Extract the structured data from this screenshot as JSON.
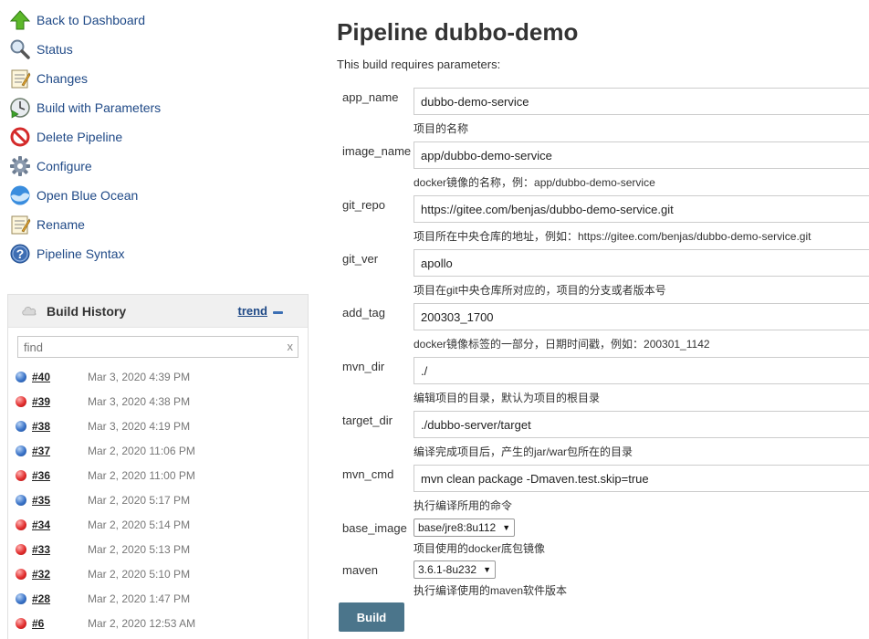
{
  "sidebar": {
    "tasks": [
      {
        "label": "Back to Dashboard",
        "icon": "up-arrow-icon"
      },
      {
        "label": "Status",
        "icon": "magnifier-icon"
      },
      {
        "label": "Changes",
        "icon": "notepad-icon"
      },
      {
        "label": "Build with Parameters",
        "icon": "clock-play-icon"
      },
      {
        "label": "Delete Pipeline",
        "icon": "no-entry-icon"
      },
      {
        "label": "Configure",
        "icon": "gear-icon"
      },
      {
        "label": "Open Blue Ocean",
        "icon": "blue-ocean-icon"
      },
      {
        "label": "Rename",
        "icon": "notepad-icon"
      },
      {
        "label": "Pipeline Syntax",
        "icon": "help-icon"
      }
    ]
  },
  "build_history": {
    "title": "Build History",
    "trend_label": "trend",
    "search_placeholder": "find",
    "clear_label": "x",
    "builds": [
      {
        "number": "#40",
        "date": "Mar 3, 2020 4:39 PM",
        "status": "blue"
      },
      {
        "number": "#39",
        "date": "Mar 3, 2020 4:38 PM",
        "status": "red"
      },
      {
        "number": "#38",
        "date": "Mar 3, 2020 4:19 PM",
        "status": "blue"
      },
      {
        "number": "#37",
        "date": "Mar 2, 2020 11:06 PM",
        "status": "blue"
      },
      {
        "number": "#36",
        "date": "Mar 2, 2020 11:00 PM",
        "status": "red"
      },
      {
        "number": "#35",
        "date": "Mar 2, 2020 5:17 PM",
        "status": "blue"
      },
      {
        "number": "#34",
        "date": "Mar 2, 2020 5:14 PM",
        "status": "red"
      },
      {
        "number": "#33",
        "date": "Mar 2, 2020 5:13 PM",
        "status": "red"
      },
      {
        "number": "#32",
        "date": "Mar 2, 2020 5:10 PM",
        "status": "red"
      },
      {
        "number": "#28",
        "date": "Mar 2, 2020 1:47 PM",
        "status": "blue"
      },
      {
        "number": "#6",
        "date": "Mar 2, 2020 12:53 AM",
        "status": "red"
      }
    ]
  },
  "main": {
    "title": "Pipeline dubbo-demo",
    "requires_text": "This build requires parameters:",
    "build_label": "Build",
    "params": [
      {
        "name": "app_name",
        "value": "dubbo-demo-service",
        "description": "项目的名称",
        "type": "text"
      },
      {
        "name": "image_name",
        "value": "app/dubbo-demo-service",
        "description": "docker镜像的名称，例：app/dubbo-demo-service",
        "type": "text"
      },
      {
        "name": "git_repo",
        "value": "https://gitee.com/benjas/dubbo-demo-service.git",
        "description": "项目所在中央仓库的地址，例如：https://gitee.com/benjas/dubbo-demo-service.git",
        "type": "text"
      },
      {
        "name": "git_ver",
        "value": "apollo",
        "description": "项目在git中央仓库所对应的，项目的分支或者版本号",
        "type": "text"
      },
      {
        "name": "add_tag",
        "value": "200303_1700",
        "description": "docker镜像标签的一部分，日期时间戳，例如：200301_1142",
        "type": "text"
      },
      {
        "name": "mvn_dir",
        "value": "./",
        "description": "编辑项目的目录，默认为项目的根目录",
        "type": "text"
      },
      {
        "name": "target_dir",
        "value": "./dubbo-server/target",
        "description": "编译完成项目后，产生的jar/war包所在的目录",
        "type": "text"
      },
      {
        "name": "mvn_cmd",
        "value": "mvn clean package -Dmaven.test.skip=true",
        "description": "执行编译所用的命令",
        "type": "text"
      },
      {
        "name": "base_image",
        "value": "base/jre8:8u112",
        "description": "项目使用的docker底包镜像",
        "type": "select"
      },
      {
        "name": "maven",
        "value": "3.6.1-8u232",
        "description": "执行编译使用的maven软件版本",
        "type": "select"
      }
    ]
  }
}
